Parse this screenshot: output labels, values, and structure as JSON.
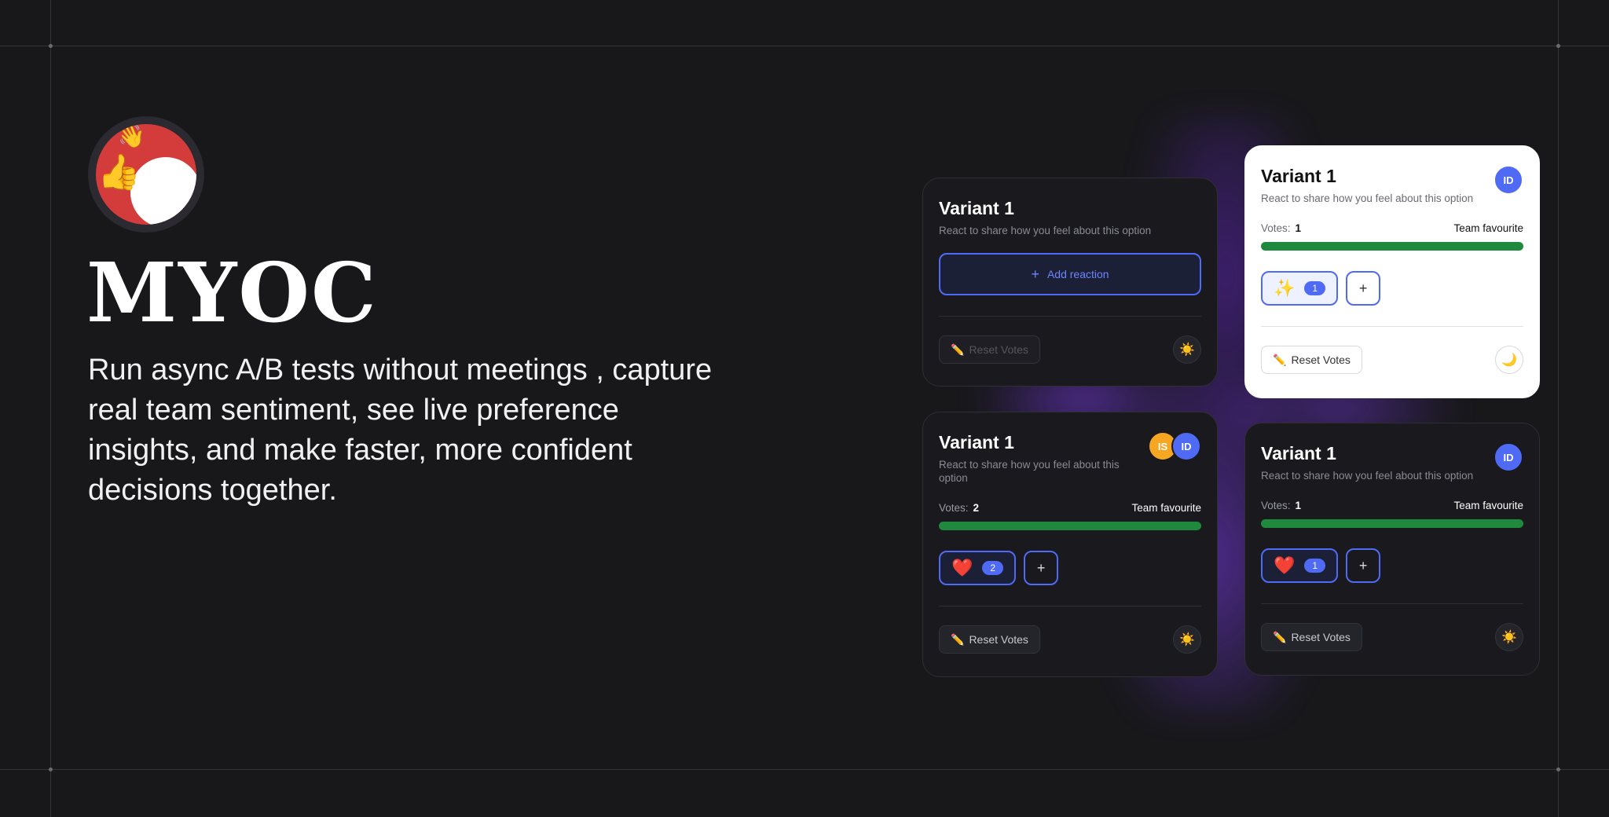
{
  "brand": {
    "name": "MYOC",
    "tagline": "Run async A/B tests without meetings , capture real team sentiment, see live preference insights, and make faster, more confident decisions together.",
    "logo_emoji": "😍",
    "logo_hand": "👍",
    "logo_hand2": "👋"
  },
  "cards": [
    {
      "title": "Variant 1",
      "subtitle": "React to share how you feel about this option",
      "add_reaction_label": "Add reaction",
      "add_reaction_icon": "+",
      "reset_label": "Reset Votes",
      "reset_icon": "✏️",
      "theme_icon": "☀️"
    },
    {
      "title": "Variant 1",
      "subtitle": "React to share how you feel about this option",
      "avatar": "ID",
      "votes_label": "Votes:",
      "votes": "1",
      "favourite_label": "Team favourite",
      "reaction_emoji": "✨",
      "reaction_count": "1",
      "add_icon": "+",
      "reset_label": "Reset Votes",
      "reset_icon": "✏️",
      "theme_icon": "🌙"
    },
    {
      "title": "Variant 1",
      "subtitle": "React to share how you feel about this option",
      "avatars": [
        "IS",
        "ID"
      ],
      "votes_label": "Votes:",
      "votes": "2",
      "favourite_label": "Team favourite",
      "reaction_emoji": "❤️",
      "reaction_count": "2",
      "add_icon": "+",
      "reset_label": "Reset Votes",
      "reset_icon": "✏️",
      "theme_icon": "☀️"
    },
    {
      "title": "Variant 1",
      "subtitle": "React to share how you feel about this option",
      "avatar": "ID",
      "votes_label": "Votes:",
      "votes": "1",
      "favourite_label": "Team favourite",
      "reaction_emoji": "❤️",
      "reaction_count": "1",
      "add_icon": "+",
      "reset_label": "Reset Votes",
      "reset_icon": "✏️",
      "theme_icon": "☀️"
    }
  ],
  "colors": {
    "background": "#18181b",
    "accent": "#4f6bf5",
    "progress": "#1f8a3d",
    "avatar_is": "#f5a623",
    "glow": "#7c3aed"
  }
}
